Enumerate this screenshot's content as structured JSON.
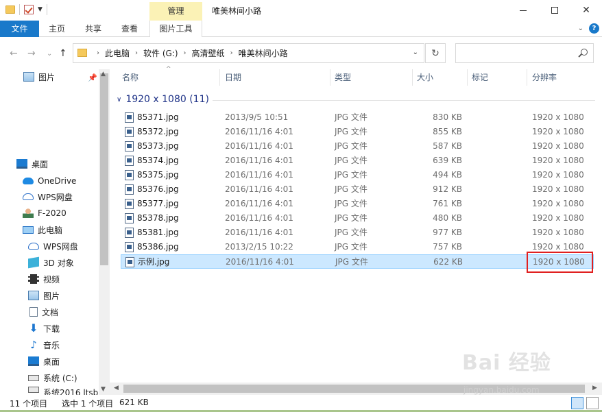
{
  "titlebar": {
    "context_group": "管理",
    "title": "唯美林间小路"
  },
  "ribbon": {
    "tabs": [
      "文件",
      "主页",
      "共享",
      "查看",
      "图片工具"
    ]
  },
  "address": {
    "crumbs": [
      "此电脑",
      "软件 (G:)",
      "高清壁纸",
      "唯美林间小路"
    ],
    "search_placeholder": ""
  },
  "nav": {
    "items": [
      {
        "label": "图片",
        "icon": "picture-icon",
        "pinned": true
      },
      {
        "label": "桌面",
        "icon": "desktop-icon"
      },
      {
        "label": "OneDrive",
        "icon": "onedrive-icon"
      },
      {
        "label": "WPS网盘",
        "icon": "wps-cloud-icon"
      },
      {
        "label": "F-2020",
        "icon": "user-icon"
      },
      {
        "label": "此电脑",
        "icon": "computer-icon"
      },
      {
        "label": "WPS网盘",
        "icon": "wps-cloud-icon"
      },
      {
        "label": "3D 对象",
        "icon": "3d-objects-icon"
      },
      {
        "label": "视频",
        "icon": "video-icon"
      },
      {
        "label": "图片",
        "icon": "picture-icon"
      },
      {
        "label": "文档",
        "icon": "document-icon"
      },
      {
        "label": "下载",
        "icon": "download-icon"
      },
      {
        "label": "音乐",
        "icon": "music-icon"
      },
      {
        "label": "桌面",
        "icon": "desktop-icon"
      },
      {
        "label": "系统 (C:)",
        "icon": "drive-icon"
      },
      {
        "label": "系统2016 ltsb",
        "icon": "drive-icon"
      }
    ]
  },
  "columns": [
    "名称",
    "日期",
    "类型",
    "大小",
    "标记",
    "分辨率"
  ],
  "group": {
    "label": "1920 x 1080 (11)"
  },
  "files": [
    {
      "name": "85371.jpg",
      "date": "2013/9/5 10:51",
      "type": "JPG 文件",
      "size": "830 KB",
      "res": "1920 x 1080"
    },
    {
      "name": "85372.jpg",
      "date": "2016/11/16 4:01",
      "type": "JPG 文件",
      "size": "855 KB",
      "res": "1920 x 1080"
    },
    {
      "name": "85373.jpg",
      "date": "2016/11/16 4:01",
      "type": "JPG 文件",
      "size": "587 KB",
      "res": "1920 x 1080"
    },
    {
      "name": "85374.jpg",
      "date": "2016/11/16 4:01",
      "type": "JPG 文件",
      "size": "639 KB",
      "res": "1920 x 1080"
    },
    {
      "name": "85375.jpg",
      "date": "2016/11/16 4:01",
      "type": "JPG 文件",
      "size": "494 KB",
      "res": "1920 x 1080"
    },
    {
      "name": "85376.jpg",
      "date": "2016/11/16 4:01",
      "type": "JPG 文件",
      "size": "912 KB",
      "res": "1920 x 1080"
    },
    {
      "name": "85377.jpg",
      "date": "2016/11/16 4:01",
      "type": "JPG 文件",
      "size": "761 KB",
      "res": "1920 x 1080"
    },
    {
      "name": "85378.jpg",
      "date": "2016/11/16 4:01",
      "type": "JPG 文件",
      "size": "480 KB",
      "res": "1920 x 1080"
    },
    {
      "name": "85381.jpg",
      "date": "2016/11/16 4:01",
      "type": "JPG 文件",
      "size": "977 KB",
      "res": "1920 x 1080"
    },
    {
      "name": "85386.jpg",
      "date": "2013/2/15 10:22",
      "type": "JPG 文件",
      "size": "757 KB",
      "res": "1920 x 1080"
    },
    {
      "name": "示例.jpg",
      "date": "2016/11/16 4:01",
      "type": "JPG 文件",
      "size": "622 KB",
      "res": "1920 x 1080",
      "selected": true
    }
  ],
  "status": {
    "count": "11 个项目",
    "selection": "选中 1 个项目",
    "selection_size": "621 KB"
  },
  "watermark": {
    "text": "Bai 经验",
    "sub": "jingyan.baidu.com"
  },
  "colors": {
    "file_tab": "#1979ca",
    "context_tab": "#fbf2b6",
    "selection": "#cce8ff",
    "highlight_box": "#e02020",
    "group_header": "#1e3287"
  }
}
